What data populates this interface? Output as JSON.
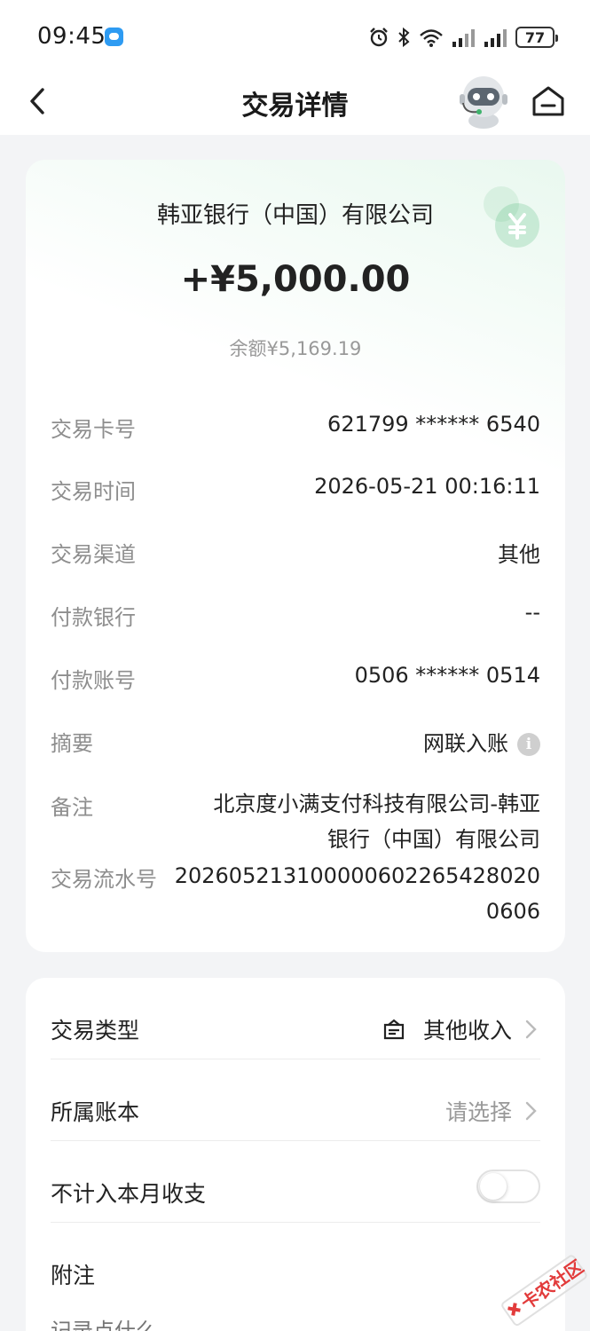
{
  "status_bar": {
    "time": "09:45",
    "battery": "77"
  },
  "header": {
    "title": "交易详情"
  },
  "transaction": {
    "bank_name": "韩亚银行（中国）有限公司",
    "amount": "+¥5,000.00",
    "balance": "余额¥5,169.19",
    "details": [
      {
        "label": "交易卡号",
        "value": "621799 ****** 6540"
      },
      {
        "label": "交易时间",
        "value": "2026-05-21 00:16:11"
      },
      {
        "label": "交易渠道",
        "value": "其他"
      },
      {
        "label": "付款银行",
        "value": "--"
      },
      {
        "label": "付款账号",
        "value": "0506 ****** 0514"
      },
      {
        "label": "摘要",
        "value": "网联入账"
      },
      {
        "label": "备注",
        "value_line1": "北京度小满支付科技有限公司-韩亚",
        "value_line2": "银行（中国）有限公司"
      },
      {
        "label": "交易流水号",
        "value_line1": "20260521310000060226542802​0",
        "value_line2": "0606"
      }
    ]
  },
  "settings": {
    "type_label": "交易类型",
    "type_value": "其他收入",
    "ledger_label": "所属账本",
    "ledger_value": "请选择",
    "exclude_label": "不计入本月收支",
    "exclude_on": false,
    "note_label": "附注",
    "note_placeholder": "记录点什么"
  },
  "watermark": "卡农社区",
  "colors": {
    "accent_green": "#3fb36c",
    "label_gray": "#8e8e8e"
  }
}
